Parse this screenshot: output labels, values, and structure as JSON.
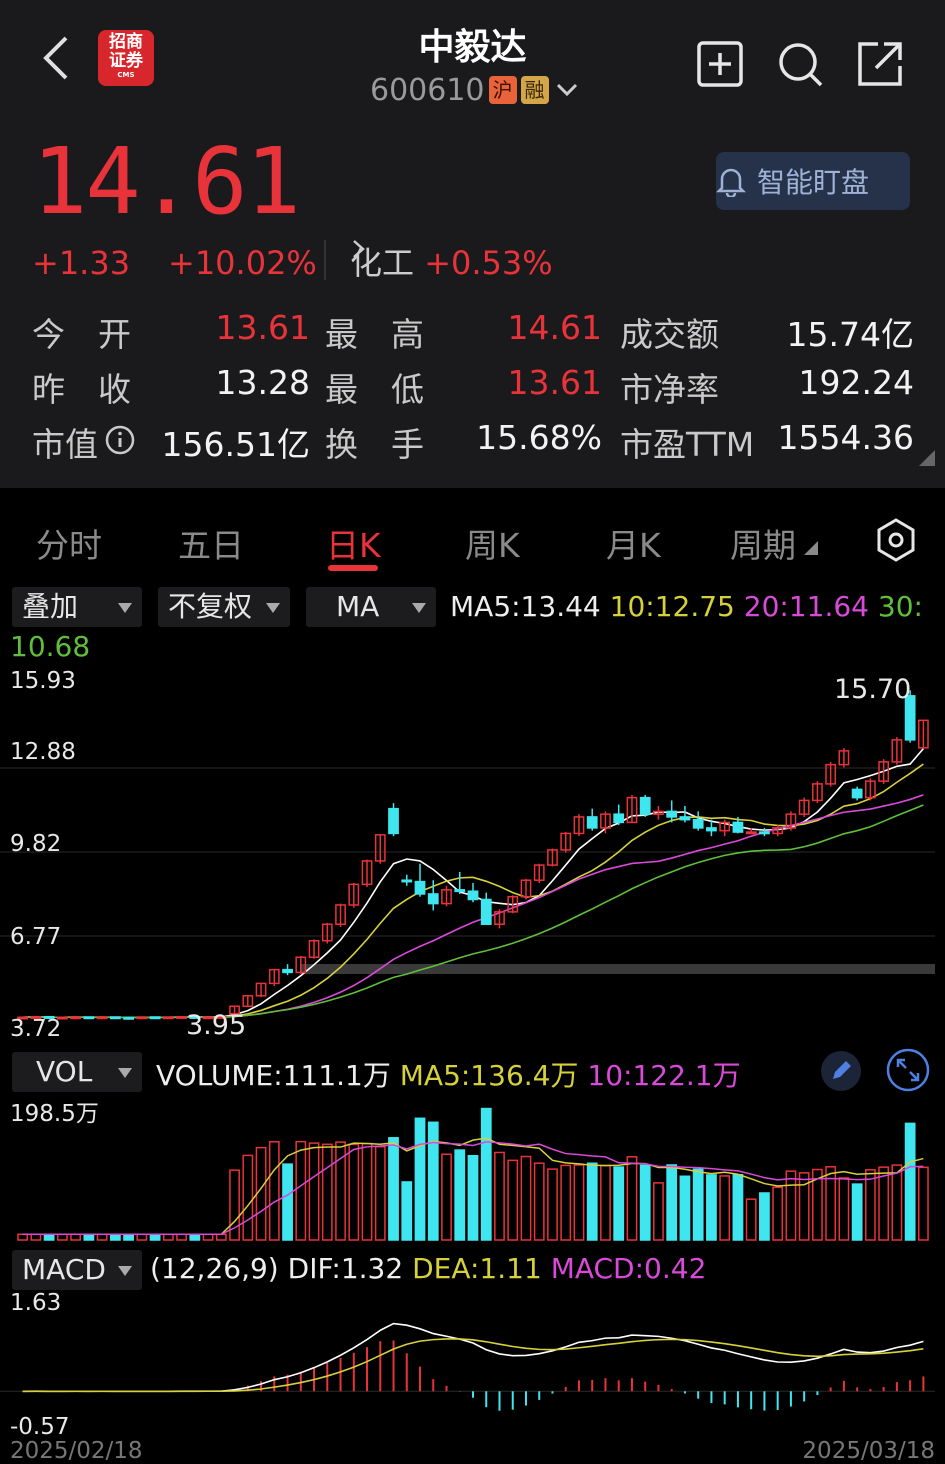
{
  "header": {
    "broker_logo": {
      "line1": "招商",
      "line2": "证券",
      "line3": "CMS"
    },
    "stock_name": "中毅达",
    "stock_code": "600610",
    "tag_hu": "沪",
    "tag_rong": "融",
    "alert_label": "智能盯盘"
  },
  "quote": {
    "price": "14.61",
    "change": "+1.33",
    "change_pct": "+10.02%",
    "sector_name": "化工",
    "sector_pct": "+0.53%"
  },
  "stats": [
    {
      "l1": "今　开",
      "v1": "13.61",
      "l2": "最　高",
      "v2": "14.61",
      "l3": "成交额",
      "v3": "15.74亿"
    },
    {
      "l1": "昨　收",
      "v1": "13.28",
      "l2": "最　低",
      "v2": "13.61",
      "l3": "市净率",
      "v3": "192.24"
    },
    {
      "l1": "市值",
      "v1": "156.51亿",
      "l2": "换　手",
      "v2": "15.68%",
      "l3": "市盈TTM",
      "v3": "1554.36"
    }
  ],
  "tabs": [
    "分时",
    "五日",
    "日K",
    "周K",
    "月K",
    "周期"
  ],
  "active_tab": "日K",
  "kline_toolbar": {
    "overlay": "叠加",
    "adjust": "不复权",
    "indicator": "MA",
    "ma5": "MA5:13.44",
    "ma10": "10:12.75",
    "ma20": "20:11.64",
    "ma30_label": "30:",
    "ma30_value": "10.68"
  },
  "kline_axis": {
    "y_labels": [
      "15.93",
      "12.88",
      "9.82",
      "6.77",
      "3.72"
    ],
    "high_marker": "15.70",
    "low_marker": "3.95"
  },
  "volume": {
    "selector": "VOL",
    "volume": "VOLUME:111.1万",
    "ma5": "MA5:136.4万",
    "ma10": "10:122.1万",
    "axis_max": "198.5万"
  },
  "macd": {
    "selector": "MACD",
    "params": "(12,26,9)",
    "dif": "DIF:1.32",
    "dea": "DEA:1.11",
    "macd": "MACD:0.42",
    "axis_max": "1.63",
    "axis_min": "-0.57"
  },
  "dates": {
    "start": "2025/02/18",
    "end": "2025/03/18"
  },
  "colors": {
    "up": "#e8333a",
    "down": "#3fe6f0",
    "ma5": "#ffffff",
    "ma10": "#d6d13b",
    "ma20": "#d94ad9",
    "ma30": "#5fbf3b",
    "panel_bg": "#1a1a1c"
  },
  "chart_data": {
    "type": "candlestick",
    "ylim": [
      3.72,
      15.93
    ],
    "candles_ohlc": [
      [
        3.8,
        3.85,
        3.78,
        3.82
      ],
      [
        3.82,
        3.86,
        3.8,
        3.84
      ],
      [
        3.84,
        3.86,
        3.79,
        3.8
      ],
      [
        3.8,
        3.83,
        3.78,
        3.82
      ],
      [
        3.82,
        3.85,
        3.8,
        3.83
      ],
      [
        3.83,
        3.84,
        3.79,
        3.81
      ],
      [
        3.81,
        3.84,
        3.79,
        3.83
      ],
      [
        3.83,
        3.85,
        3.8,
        3.81
      ],
      [
        3.81,
        3.83,
        3.78,
        3.8
      ],
      [
        3.8,
        3.84,
        3.79,
        3.83
      ],
      [
        3.83,
        3.85,
        3.8,
        3.82
      ],
      [
        3.82,
        3.84,
        3.79,
        3.83
      ],
      [
        3.83,
        3.86,
        3.8,
        3.84
      ],
      [
        3.84,
        3.87,
        3.81,
        3.82
      ],
      [
        3.82,
        3.85,
        3.8,
        3.83
      ],
      [
        3.83,
        3.86,
        3.81,
        3.84
      ],
      [
        3.95,
        4.22,
        3.95,
        4.22
      ],
      [
        4.22,
        4.6,
        4.2,
        4.6
      ],
      [
        4.6,
        5.05,
        4.55,
        5.05
      ],
      [
        5.05,
        5.55,
        4.95,
        5.55
      ],
      [
        5.55,
        5.75,
        5.35,
        5.45
      ],
      [
        5.45,
        6.05,
        5.4,
        6.0
      ],
      [
        6.0,
        6.65,
        5.95,
        6.6
      ],
      [
        6.6,
        7.25,
        6.5,
        7.2
      ],
      [
        7.2,
        7.95,
        7.1,
        7.9
      ],
      [
        7.9,
        8.7,
        7.8,
        8.65
      ],
      [
        8.65,
        9.55,
        8.55,
        9.5
      ],
      [
        9.5,
        10.45,
        9.4,
        10.45
      ],
      [
        11.4,
        11.6,
        10.4,
        10.5
      ],
      [
        8.8,
        9.0,
        8.6,
        8.75
      ],
      [
        8.75,
        9.4,
        8.2,
        8.3
      ],
      [
        8.3,
        8.8,
        7.7,
        7.95
      ],
      [
        7.95,
        8.6,
        7.85,
        8.45
      ],
      [
        8.45,
        9.1,
        8.3,
        8.4
      ],
      [
        8.4,
        8.7,
        8.0,
        8.1
      ],
      [
        8.1,
        8.35,
        7.2,
        7.2
      ],
      [
        7.2,
        7.75,
        7.05,
        7.65
      ],
      [
        7.65,
        8.25,
        7.6,
        8.2
      ],
      [
        8.2,
        8.85,
        8.1,
        8.8
      ],
      [
        8.8,
        9.4,
        8.7,
        9.35
      ],
      [
        9.35,
        9.95,
        9.3,
        9.9
      ],
      [
        9.9,
        10.55,
        9.8,
        10.5
      ],
      [
        10.5,
        11.2,
        10.4,
        11.1
      ],
      [
        11.1,
        11.4,
        10.6,
        10.7
      ],
      [
        10.7,
        11.3,
        10.5,
        11.2
      ],
      [
        11.2,
        11.55,
        10.8,
        10.9
      ],
      [
        10.9,
        11.9,
        10.9,
        11.8
      ],
      [
        11.8,
        11.9,
        11.1,
        11.2
      ],
      [
        11.2,
        11.5,
        11.0,
        11.3
      ],
      [
        11.3,
        11.7,
        10.9,
        11.1
      ],
      [
        11.1,
        11.5,
        10.9,
        11.0
      ],
      [
        11.0,
        11.3,
        10.6,
        10.7
      ],
      [
        10.7,
        11.0,
        10.4,
        10.6
      ],
      [
        10.6,
        11.0,
        10.4,
        10.9
      ],
      [
        10.9,
        11.1,
        10.5,
        10.55
      ],
      [
        10.55,
        10.7,
        10.5,
        10.55
      ],
      [
        10.55,
        10.7,
        10.4,
        10.5
      ],
      [
        10.5,
        10.8,
        10.4,
        10.7
      ],
      [
        10.7,
        11.3,
        10.6,
        11.2
      ],
      [
        11.2,
        11.8,
        11.1,
        11.7
      ],
      [
        11.7,
        12.4,
        11.6,
        12.3
      ],
      [
        12.3,
        13.1,
        12.2,
        13.0
      ],
      [
        13.0,
        13.6,
        12.9,
        13.5
      ],
      [
        12.1,
        12.2,
        11.7,
        11.8
      ],
      [
        11.8,
        12.5,
        11.7,
        12.4
      ],
      [
        12.4,
        13.2,
        12.3,
        13.1
      ],
      [
        13.1,
        14.0,
        13.0,
        13.9
      ],
      [
        15.5,
        15.7,
        13.8,
        13.9
      ],
      [
        13.61,
        14.61,
        13.61,
        14.61
      ]
    ],
    "volume_max": 198.5,
    "macd_ylim": [
      -0.57,
      1.63
    ]
  }
}
